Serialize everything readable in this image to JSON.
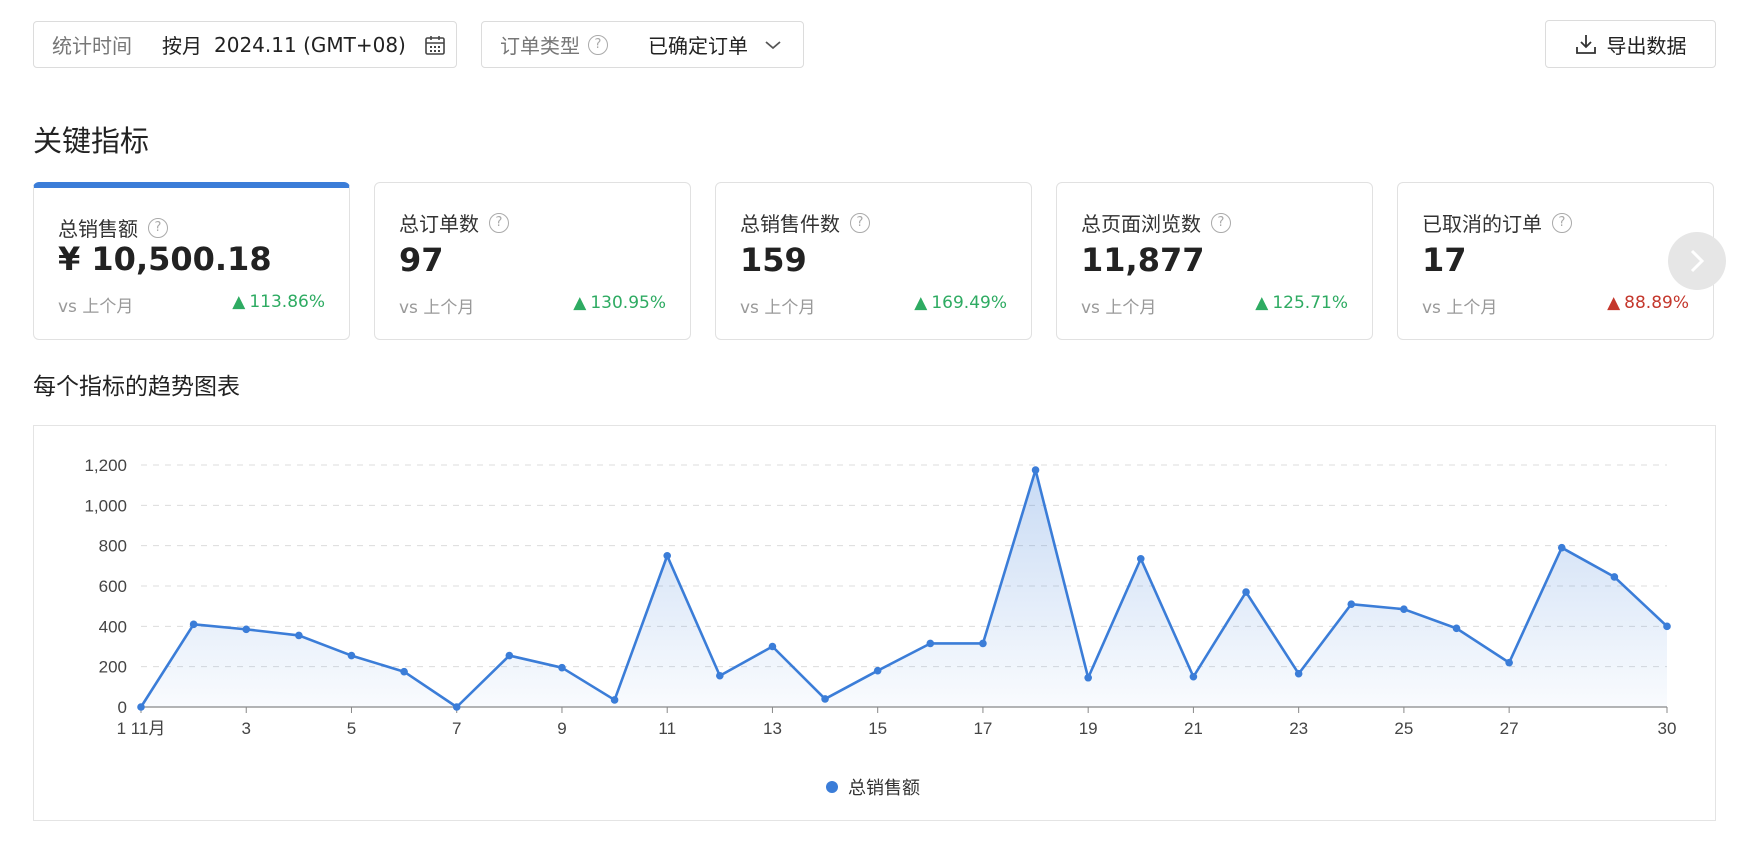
{
  "filters": {
    "date": {
      "label": "统计时间",
      "mode": "按月",
      "value": "2024.11 (GMT+08)"
    },
    "order_type": {
      "label": "订单类型",
      "value": "已确定订单"
    },
    "export_label": "导出数据"
  },
  "section_title": "关键指标",
  "cards": [
    {
      "title": "总销售额",
      "value": "¥ 10,500.18",
      "vs": "vs 上个月",
      "change": "113.86%",
      "direction": "up"
    },
    {
      "title": "总订单数",
      "value": "97",
      "vs": "vs 上个月",
      "change": "130.95%",
      "direction": "up"
    },
    {
      "title": "总销售件数",
      "value": "159",
      "vs": "vs 上个月",
      "change": "169.49%",
      "direction": "up"
    },
    {
      "title": "总页面浏览数",
      "value": "11,877",
      "vs": "vs 上个月",
      "change": "125.71%",
      "direction": "up"
    },
    {
      "title": "已取消的订单",
      "value": "17",
      "vs": "vs 上个月",
      "change": "88.89%",
      "direction": "up"
    }
  ],
  "chart_title": "每个指标的趋势图表",
  "colors": {
    "accent": "#3b7dd8",
    "up": "#2eab62",
    "down": "#c4372c"
  },
  "chart_data": {
    "type": "area",
    "title": "",
    "xlabel": "",
    "ylabel": "",
    "x": [
      1,
      2,
      3,
      4,
      5,
      6,
      7,
      8,
      9,
      10,
      11,
      12,
      13,
      14,
      15,
      16,
      17,
      18,
      19,
      20,
      21,
      22,
      23,
      24,
      25,
      26,
      27,
      28,
      29,
      30
    ],
    "x_tick_labels": [
      "1 11月",
      "3",
      "5",
      "7",
      "9",
      "11",
      "13",
      "15",
      "17",
      "19",
      "21",
      "23",
      "25",
      "27",
      "30"
    ],
    "x_tick_values": [
      1,
      3,
      5,
      7,
      9,
      11,
      13,
      15,
      17,
      19,
      21,
      23,
      25,
      27,
      30
    ],
    "ylim": [
      0,
      1200
    ],
    "y_ticks": [
      0,
      200,
      400,
      600,
      800,
      1000,
      1200
    ],
    "y_tick_labels": [
      "0",
      "200",
      "400",
      "600",
      "800",
      "1,000",
      "1,200"
    ],
    "grid": true,
    "legend_position": "bottom-center",
    "series": [
      {
        "name": "总销售额",
        "values": [
          0,
          410,
          385,
          355,
          255,
          175,
          0,
          255,
          195,
          35,
          750,
          155,
          300,
          40,
          180,
          315,
          315,
          1175,
          145,
          735,
          150,
          570,
          165,
          510,
          485,
          390,
          220,
          790,
          645,
          400
        ]
      }
    ]
  }
}
